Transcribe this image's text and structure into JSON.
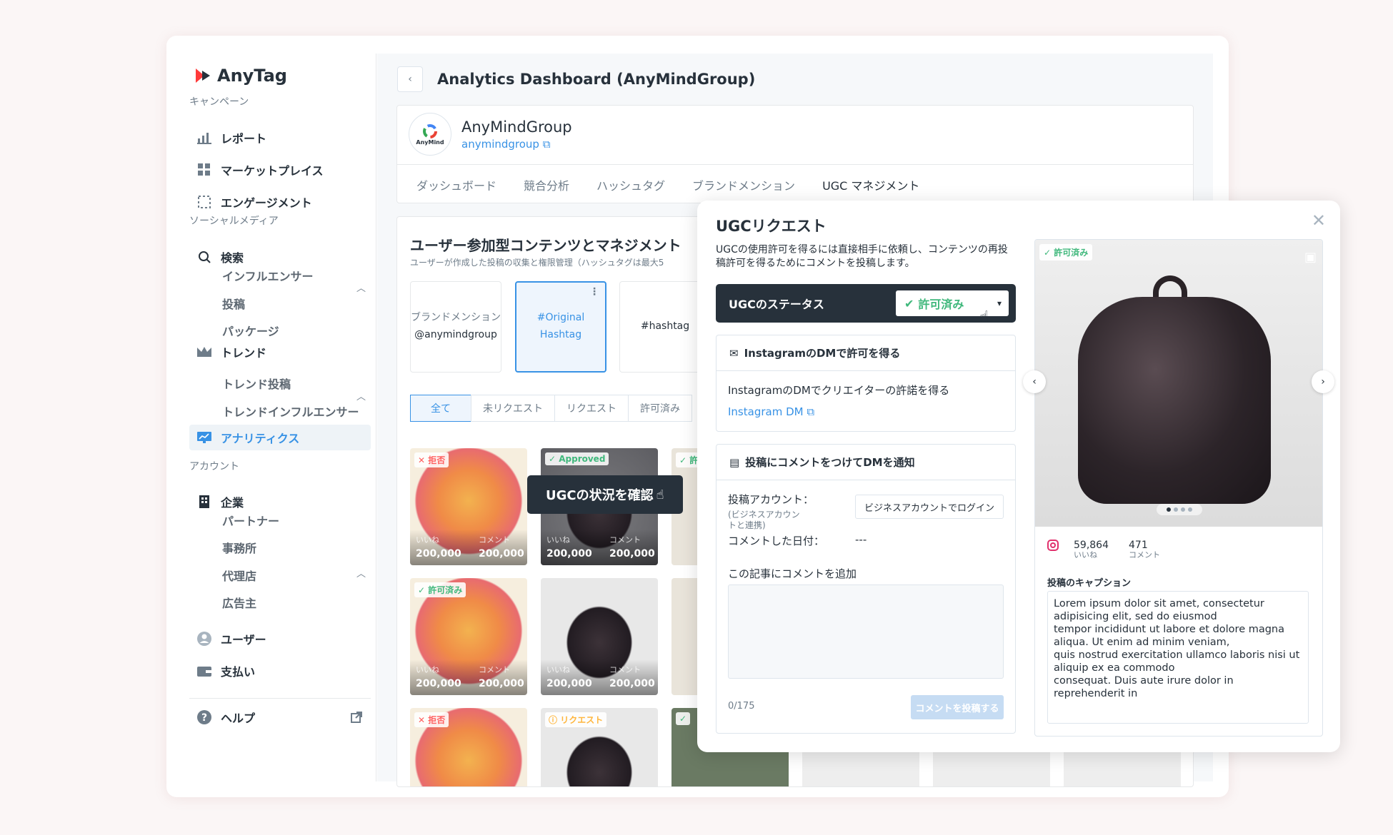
{
  "app": {
    "logo_text": "AnyTag"
  },
  "sidebar": {
    "campaign_label": "キャンペーン",
    "campaign_items": [
      {
        "label": "レポート",
        "icon": "bar-chart-icon"
      },
      {
        "label": "マーケットプレイス",
        "icon": "grid-icon"
      },
      {
        "label": "エンゲージメント",
        "icon": "frame-icon"
      }
    ],
    "social_label": "ソーシャルメディア",
    "search": {
      "label": "検索",
      "icon": "search-icon"
    },
    "search_subs": [
      "インフルエンサー",
      "投稿",
      "パッケージ"
    ],
    "trend": {
      "label": "トレンド",
      "icon": "crown-icon"
    },
    "trend_subs": [
      "トレンド投稿",
      "トレンドインフルエンサー"
    ],
    "analytics": {
      "label": "アナリティクス",
      "icon": "analytics-icon"
    },
    "account_label": "アカウント",
    "company": {
      "label": "企業",
      "icon": "building-icon"
    },
    "company_subs": [
      "パートナー",
      "事務所",
      "代理店",
      "広告主"
    ],
    "user": {
      "label": "ユーザー",
      "icon": "user-icon"
    },
    "payment": {
      "label": "支払い",
      "icon": "wallet-icon"
    },
    "help": {
      "label": "ヘルプ",
      "icon": "help-icon"
    }
  },
  "header": {
    "title": "Analytics Dashboard (AnyMindGroup)"
  },
  "profile": {
    "name": "AnyMindGroup",
    "handle": "anymindgroup",
    "avatar_text": "AnyMind"
  },
  "tabs": [
    "ダッシュボード",
    "競合分析",
    "ハッシュタグ",
    "ブランドメンション",
    "UGC マネジメント"
  ],
  "ugc": {
    "title": "ユーザー参加型コンテンツとマネジメント",
    "subtitle": "ユーザーが作成した投稿の収集と権限管理（ハッシュタグは最大5",
    "sources": [
      {
        "line1": "ブランドメンション",
        "line2": "@anymindgroup"
      },
      {
        "line1": "#Original",
        "line2": "Hashtag"
      },
      {
        "line1": "#hashtag",
        "line2": ""
      }
    ],
    "filters": [
      "全て",
      "未リクエスト",
      "リクエスト",
      "許可済み"
    ],
    "likes_label": "いいね",
    "comments_label": "コメント",
    "grid_value": "200,000",
    "badges": {
      "rejected": "拒否",
      "approved_en": "Approved",
      "approved": "許可済み",
      "request": "リクエスト",
      "approved_short": "許可"
    },
    "tooltip": "UGCの状況を確認"
  },
  "modal": {
    "title": "UGCリクエスト",
    "description": "UGCの使用許可を得るには直接相手に依頼し、コンテンツの再投稿許可を得るためにコメントを投稿します。",
    "status_label": "UGCのステータス",
    "status_value": "許可済み",
    "dm_section": {
      "title": "InstagramのDMで許可を得る",
      "text": "InstagramのDMでクリエイターの許諾を得る",
      "link": "Instagram DM"
    },
    "comment_section": {
      "title": "投稿にコメントをつけてDMを通知",
      "account_label": "投稿アカウント：",
      "account_note1": "(ビジネスアカウン",
      "account_note2": "トと連携)",
      "login_button": "ビジネスアカウントでログイン",
      "date_label": "コメントした日付：",
      "date_value": "---",
      "add_label": "この記事にコメントを追加",
      "counter": "0/175",
      "post_button": "コメントを投稿する"
    },
    "post": {
      "badge": "許可済み",
      "likes": "59,864",
      "likes_label": "いいね",
      "comments": "471",
      "comments_label": "コメント",
      "caption_label": "投稿のキャプション",
      "caption": "Lorem ipsum dolor sit amet, consectetur\nadipisicing elit, sed do eiusmod\ntempor incididunt ut labore et dolore magna\naliqua. Ut enim ad minim veniam,\nquis nostrud exercitation ullamco laboris nisi ut\naliquip ex ea commodo\nconsequat. Duis aute irure dolor in\nreprehenderit in"
    }
  },
  "colors": {
    "accent": "#3892e5",
    "approved": "#40b87c",
    "rejected": "#ff5f5f",
    "request": "#ffb63d",
    "dark": "#27313b"
  }
}
